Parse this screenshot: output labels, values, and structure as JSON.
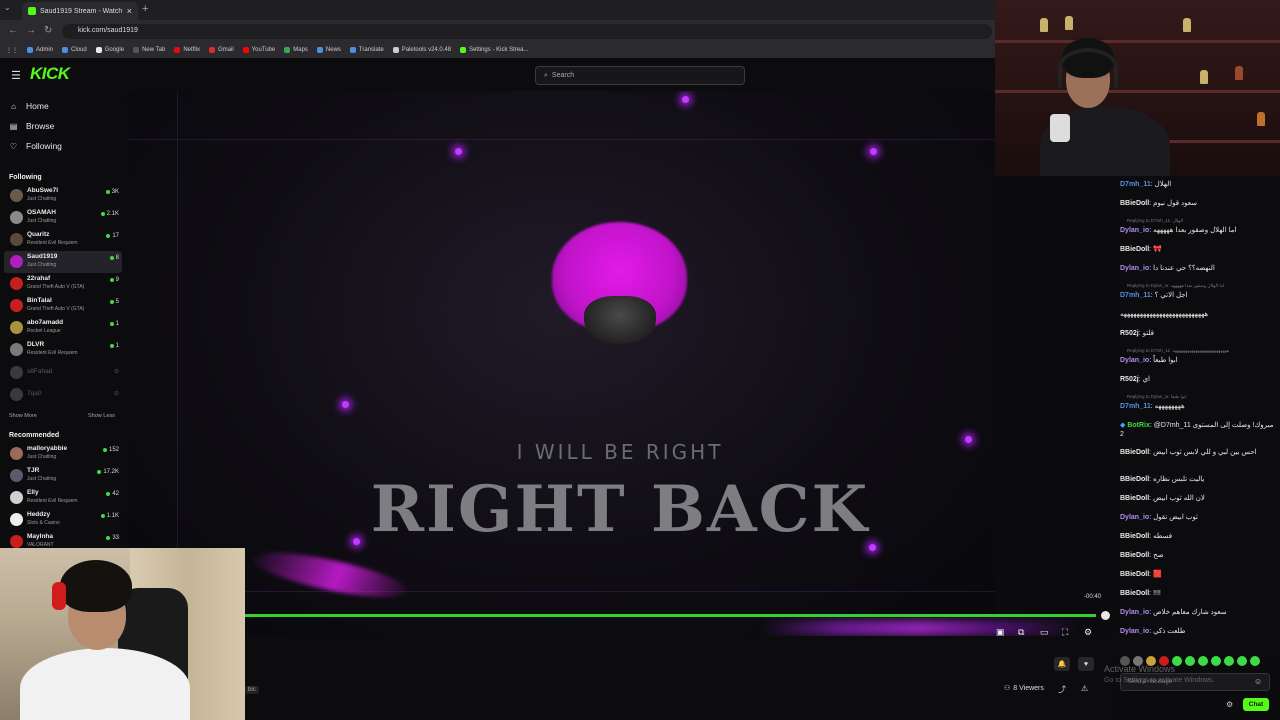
{
  "browser": {
    "tab_title": "Saud1919 Stream - Watch Live ...",
    "tab_close": "×",
    "new_tab": "+",
    "url": "kick.com/saud1919",
    "bookmarks": [
      {
        "label": "Admin",
        "color": "#4a90e2"
      },
      {
        "label": "Cloud",
        "color": "#4a90e2"
      },
      {
        "label": "Google",
        "color": "#eaeaea"
      },
      {
        "label": "New Tab",
        "color": "#555555"
      },
      {
        "label": "Netflix",
        "color": "#e50914"
      },
      {
        "label": "Gmail",
        "color": "#d93025"
      },
      {
        "label": "YouTube",
        "color": "#ff0000"
      },
      {
        "label": "Maps",
        "color": "#34a853"
      },
      {
        "label": "News",
        "color": "#4a90e2"
      },
      {
        "label": "Translate",
        "color": "#4a90e2"
      },
      {
        "label": "Paletools v24.0.48",
        "color": "#cccccc"
      },
      {
        "label": "Settings - Kick Strea...",
        "color": "#53fc18"
      }
    ]
  },
  "kick": {
    "logo": "KICK",
    "search_placeholder": "Search",
    "nav": [
      {
        "label": "Home",
        "icon": "home-icon"
      },
      {
        "label": "Browse",
        "icon": "browse-icon"
      },
      {
        "label": "Following",
        "icon": "heart-icon"
      }
    ],
    "following_title": "Following",
    "following": [
      {
        "name": "AbuSwe7l",
        "category": "Just Chatting",
        "viewers": "3K",
        "avatar": "#6b5a4a"
      },
      {
        "name": "OSAMAH",
        "category": "Just Chatting",
        "viewers": "2.1K",
        "avatar": "#8a8a8a"
      },
      {
        "name": "Quaritz",
        "category": "Resident Evil Requiem",
        "viewers": "17",
        "avatar": "#5a4a3a"
      },
      {
        "name": "Saud1919",
        "category": "Just Chatting",
        "viewers": "8",
        "avatar": "#b01ec0"
      },
      {
        "name": "22rahaf",
        "category": "Grand Theft Auto V (GTA)",
        "viewers": "9",
        "avatar": "#c81e1e"
      },
      {
        "name": "BinTalal",
        "category": "Grand Theft Auto V (GTA)",
        "viewers": "5",
        "avatar": "#c81e1e"
      },
      {
        "name": "abo7amadd",
        "category": "Rocket League",
        "viewers": "1",
        "avatar": "#a8913f"
      },
      {
        "name": "DLVR",
        "category": "Resident Evil Requiem",
        "viewers": "1",
        "avatar": "#7a7a7a"
      }
    ],
    "following_offline": [
      "s8Fahad",
      "7qa0"
    ],
    "show_more": "Show More",
    "show_less": "Show Less",
    "recommended_title": "Recommended",
    "recommended": [
      {
        "name": "malloryabbie",
        "category": "Just Chatting",
        "viewers": "152",
        "avatar": "#9a6a5a"
      },
      {
        "name": "TJR",
        "category": "Just Chatting",
        "viewers": "17.2K",
        "avatar": "#5a5a6a"
      },
      {
        "name": "Elly",
        "category": "Resident Evil Requiem",
        "viewers": "42",
        "avatar": "#d0d0d0"
      },
      {
        "name": "Heddzy",
        "category": "Slots & Casino",
        "viewers": "1.1K",
        "avatar": "#eeeeee"
      },
      {
        "name": "Maylnha",
        "category": "VALORANT",
        "viewers": "33",
        "avatar": "#c81e1e"
      }
    ]
  },
  "player": {
    "overlay_line1": "I WILL BE RIGHT",
    "overlay_line2": "RIGHT BACK",
    "time": "-00:40",
    "progress": 0.99,
    "viewers": "8 Viewers",
    "accent": "#53fc18",
    "bottom_label": "bic"
  },
  "chat": {
    "messages": [
      {
        "user": "D7mh_11",
        "text": "الهلال",
        "color": "#5b8de6",
        "reply": ""
      },
      {
        "user": "BBieDoll",
        "text": "سعود قول نيوم",
        "color": "#e9e9e9",
        "reply": ""
      },
      {
        "user": "",
        "text": "",
        "color": "",
        "reply": "Replying to D7mh_11: الهلال"
      },
      {
        "user": "Dylan_io",
        "text": "اما الهلال وصقور بعدا هههههه",
        "color": "#b08cf0",
        "reply": ""
      },
      {
        "user": "BBieDoll",
        "text": "🎀",
        "color": "#e9e9e9",
        "reply": ""
      },
      {
        "user": "Dylan_io",
        "text": "النهضه؟؟ حي عندنا دا",
        "color": "#b08cf0",
        "reply": ""
      },
      {
        "user": "",
        "text": "",
        "color": "",
        "reply": "Replying to Dylan_io: اما الهلال وصقور بعدا هههههه"
      },
      {
        "user": "D7mh_11",
        "text": "اجل الاتي ؟",
        "color": "#5b8de6",
        "reply": ""
      },
      {
        "user": "",
        "text": "ههههههههههههههههههههههههههه",
        "color": "#e9e9e9",
        "reply": ""
      },
      {
        "user": "R502j",
        "text": "قلتو",
        "color": "#e9e9e9",
        "reply": ""
      },
      {
        "user": "",
        "text": "",
        "color": "",
        "reply": "Replying to D7mh_11: ههههههههههههههههههههههههههه"
      },
      {
        "user": "Dylan_io",
        "text": "ابوا طبعاً",
        "color": "#b08cf0",
        "reply": ""
      },
      {
        "user": "R502j",
        "text": "اي",
        "color": "#e9e9e9",
        "reply": ""
      },
      {
        "user": "",
        "text": "",
        "color": "",
        "reply": "Replying to Dylan_io: ابوا طبعاً"
      },
      {
        "user": "D7mh_11",
        "text": "ههههههههه",
        "color": "#5b8de6",
        "reply": ""
      },
      {
        "user": "BotRix",
        "text": "@D7mh_11 مبروك! وصلت إلى المستوى 2",
        "color": "#3ddc46",
        "reply": ""
      },
      {
        "user": "BBieDoll",
        "text": "احس بين لبي و للي لابس ثوب ابيض",
        "color": "#e9e9e9",
        "reply": ""
      },
      {
        "user": "BBieDoll",
        "text": "ياليت تلبس نظاره",
        "color": "#e9e9e9",
        "reply": ""
      },
      {
        "user": "BBieDoll",
        "text": "لان الله ثوب ابيض",
        "color": "#e9e9e9",
        "reply": ""
      },
      {
        "user": "Dylan_io",
        "text": "ثوب ابيض تقول",
        "color": "#b08cf0",
        "reply": ""
      },
      {
        "user": "BBieDoll",
        "text": "فسطه",
        "color": "#e9e9e9",
        "reply": ""
      },
      {
        "user": "BBieDoll",
        "text": "صح",
        "color": "#e9e9e9",
        "reply": ""
      },
      {
        "user": "BBieDoll",
        "text": "🟥",
        "color": "#e9e9e9",
        "reply": ""
      },
      {
        "user": "BBieDoll",
        "text": "!!!!",
        "color": "#e9e9e9",
        "reply": ""
      },
      {
        "user": "Dylan_io",
        "text": "سعود شارك معاهم خلاص",
        "color": "#b08cf0",
        "reply": ""
      },
      {
        "user": "Dylan_io",
        "text": "طلعت ذكي",
        "color": "#b08cf0",
        "reply": ""
      }
    ],
    "input_placeholder": "Send a message",
    "chat_button": "Chat",
    "watermark_line1": "Activate Windows",
    "watermark_line2": "Go to Settings to activate Windows."
  }
}
